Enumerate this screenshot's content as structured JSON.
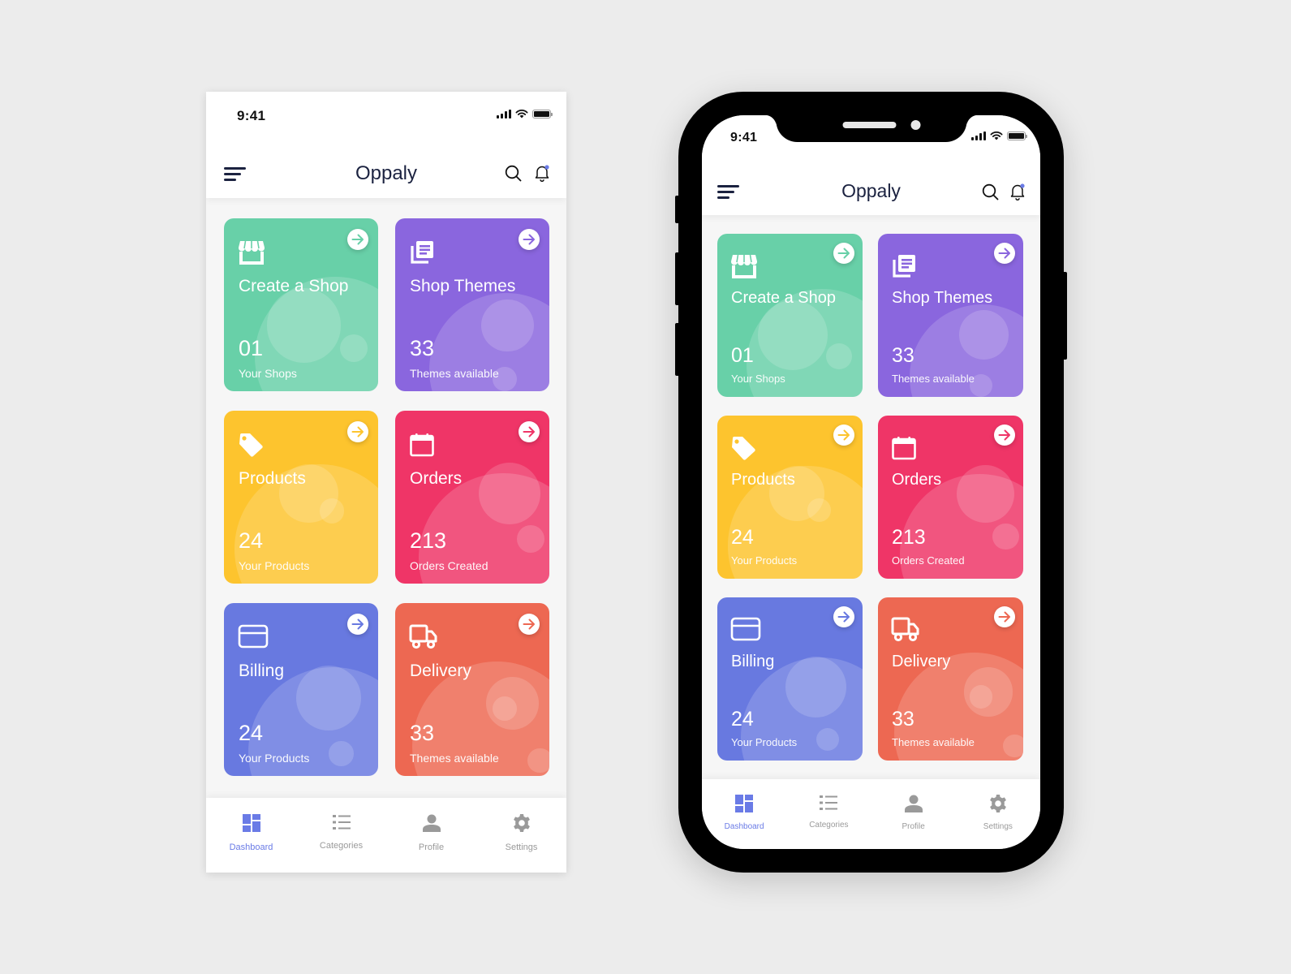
{
  "colors": {
    "background": "#ececec",
    "navy": "#1b2240",
    "active_tab": "#6a7be6",
    "inactive_tab": "#9a9a9a",
    "notification_dot": "#6a7be6"
  },
  "status_bar": {
    "time": "9:41",
    "icons": [
      "cellular-signal-icon",
      "wifi-icon",
      "battery-icon"
    ]
  },
  "header": {
    "title": "Oppaly",
    "left_icon": "menu-icon",
    "right_icons": [
      "search-icon",
      "bell-icon"
    ]
  },
  "cards": [
    {
      "id": "create-shop",
      "title": "Create a Shop",
      "count": "01",
      "subtitle": "Your Shops",
      "icon": "store-icon",
      "color": "#68d0a8"
    },
    {
      "id": "shop-themes",
      "title": "Shop Themes",
      "count": "33",
      "subtitle": "Themes available",
      "icon": "library-icon",
      "color": "#8a66de"
    },
    {
      "id": "products",
      "title": "Products",
      "count": "24",
      "subtitle": "Your Products",
      "icon": "tag-icon",
      "color": "#fdc42e"
    },
    {
      "id": "orders",
      "title": "Orders",
      "count": "213",
      "subtitle": "Orders Created",
      "icon": "calendar-icon",
      "color": "#ef3567"
    },
    {
      "id": "billing",
      "title": "Billing",
      "count": "24",
      "subtitle": "Your Products",
      "icon": "credit-card-icon",
      "color": "#6879e0"
    },
    {
      "id": "delivery",
      "title": "Delivery",
      "count": "33",
      "subtitle": "Themes available",
      "icon": "truck-icon",
      "color": "#ed6852"
    }
  ],
  "tabbar": {
    "active": "Dashboard",
    "items": [
      {
        "label": "Dashboard",
        "icon": "dashboard-icon"
      },
      {
        "label": "Categories",
        "icon": "list-icon"
      },
      {
        "label": "Profile",
        "icon": "person-icon"
      },
      {
        "label": "Settings",
        "icon": "gear-icon"
      }
    ]
  }
}
